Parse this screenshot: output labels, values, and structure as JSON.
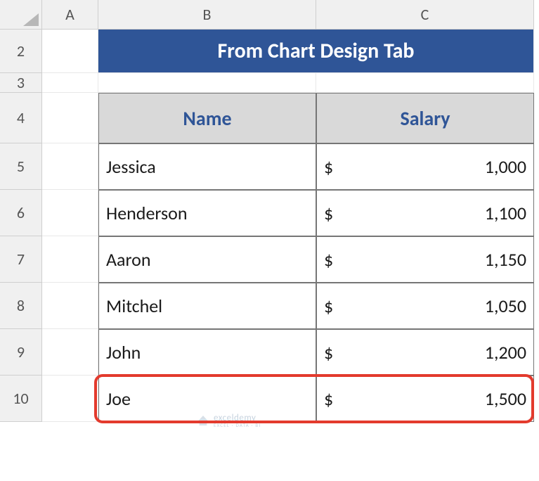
{
  "columns": {
    "A": "A",
    "B": "B",
    "C": "C"
  },
  "rows": {
    "r2": "2",
    "r3": "3",
    "r4": "4",
    "r5": "5",
    "r6": "6",
    "r7": "7",
    "r8": "8",
    "r9": "9",
    "r10": "10"
  },
  "title": "From Chart Design Tab",
  "headers": {
    "name": "Name",
    "salary": "Salary"
  },
  "currency": "$",
  "data": [
    {
      "name": "Jessica",
      "salary": "1,000"
    },
    {
      "name": "Henderson",
      "salary": "1,100"
    },
    {
      "name": "Aaron",
      "salary": "1,150"
    },
    {
      "name": "Mitchel",
      "salary": "1,050"
    },
    {
      "name": "John",
      "salary": "1,200"
    },
    {
      "name": "Joe",
      "salary": "1,500"
    }
  ],
  "watermark": {
    "main": "exceldemy",
    "sub": "EXCEL · DATA · BI"
  }
}
